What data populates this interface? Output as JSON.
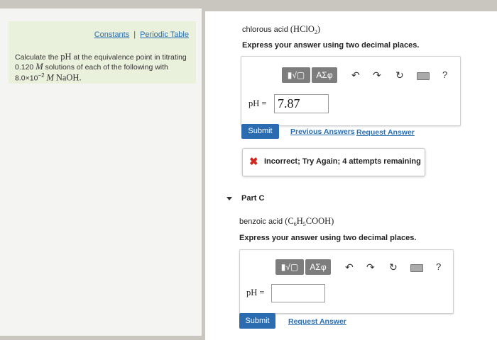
{
  "sidebar": {
    "links": {
      "constants": "Constants",
      "separator": "|",
      "periodic_table": "Periodic Table"
    },
    "instructions": {
      "line1_a": "Calculate the ",
      "line1_ph": "pH",
      "line1_b": " at the equivalence point in titrating",
      "line2_conc": "0.120",
      "line2_unit": "M",
      "line2_b": " solutions of each of the following with",
      "line3_conc": "8.0×10",
      "line3_exp": "−2",
      "line3_unit": "M",
      "line3_base": "NaOH."
    }
  },
  "part_b": {
    "acid_name": "chlorous acid",
    "acid_formula": "(HClO",
    "acid_sub": "2",
    "acid_close": ")",
    "instruction": "Express your answer using two decimal places.",
    "ph_label": "pH =",
    "answer_value": "7.87",
    "submit_label": "Submit",
    "previous_answers_label": "Previous Answers",
    "request_answer_label": "Request Answer",
    "feedback": "Incorrect; Try Again; 4 attempts remaining"
  },
  "part_c": {
    "title": "Part C",
    "acid_name": "benzoic acid",
    "acid_formula": "(C",
    "sub1": "6",
    "mid": "H",
    "sub2": "5",
    "tail": "COOH)",
    "instruction": "Express your answer using two decimal places.",
    "ph_label": "pH =",
    "answer_value": "",
    "submit_label": "Submit",
    "request_answer_label": "Request Answer"
  },
  "toolbar": {
    "templates_label": "▮√▢",
    "symbols_label": "ΑΣφ",
    "undo": "↶",
    "redo": "↷",
    "reset": "↻",
    "help": "?"
  },
  "colors": {
    "accent": "#2b6cb0",
    "link": "#2a6fb0",
    "incorrect": "#d0271d",
    "intro_bg": "#e9f0dc"
  },
  "icons": [
    "undo-icon",
    "redo-icon",
    "reset-icon",
    "keyboard-icon",
    "help-icon",
    "incorrect-icon",
    "caret-down-icon"
  ]
}
